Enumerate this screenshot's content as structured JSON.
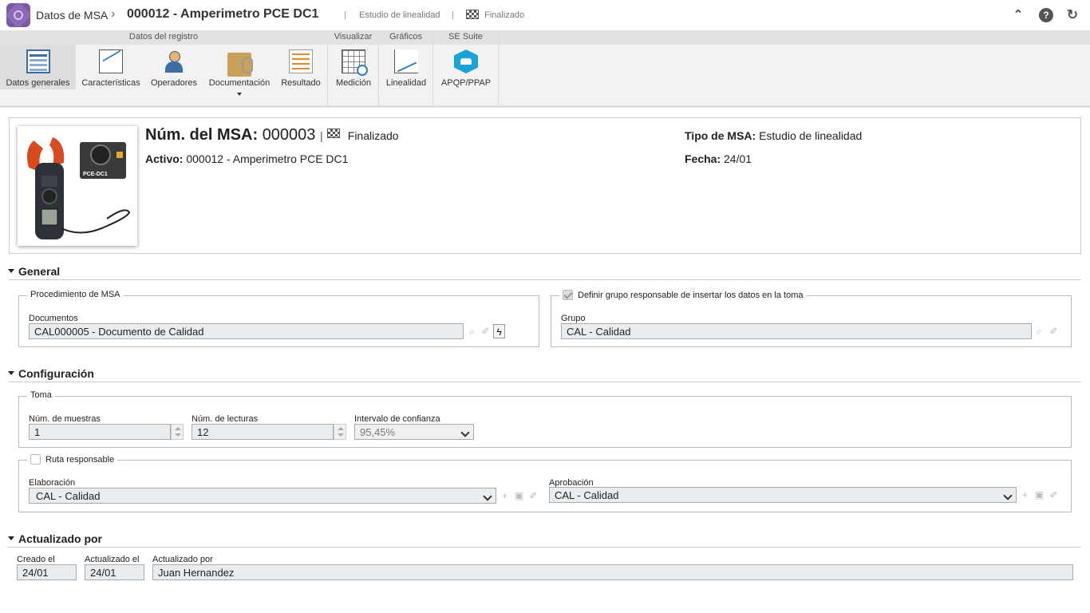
{
  "header": {
    "app_title": "Datos de MSA",
    "record_title": "000012 - Amperimetro PCE DC1",
    "study_type": "Estudio de linealidad",
    "status": "Finalizado"
  },
  "ribbon": {
    "groups": [
      {
        "label": "Datos del registro"
      },
      {
        "label": "Visualizar"
      },
      {
        "label": "Gráficos"
      },
      {
        "label": "SE Suite"
      }
    ],
    "buttons": [
      {
        "label": "Datos generales",
        "icon": "document-list-icon",
        "active": true
      },
      {
        "label": "Características",
        "icon": "chart-icon"
      },
      {
        "label": "Operadores",
        "icon": "user-icon"
      },
      {
        "label": "Documentación",
        "icon": "folder-attachment-icon"
      },
      {
        "label": "Resultado",
        "icon": "result-sheet-icon"
      },
      {
        "label": "Medición",
        "icon": "grid-magnifier-icon"
      },
      {
        "label": "Linealidad",
        "icon": "line-chart-icon"
      },
      {
        "label": "APQP/PPAP",
        "icon": "car-hexagon-icon"
      }
    ]
  },
  "record": {
    "msa_label": "Núm. del MSA:",
    "msa_number": "000003",
    "msa_status": "Finalizado",
    "asset_label": "Activo:",
    "asset_value": "000012 - Amperimetro PCE DC1",
    "type_label": "Tipo de MSA:",
    "type_value": "Estudio de linealidad",
    "date_label": "Fecha:",
    "date_value": "24/01",
    "photo_text": "PCE-DC1"
  },
  "general": {
    "title": "General",
    "procedure_legend": "Procedimiento de MSA",
    "documents_label": "Documentos",
    "documents_value": "CAL000005 - Documento de Calidad",
    "group_legend": "Definir grupo responsable de insertar los datos en la toma",
    "group_label": "Grupo",
    "group_value": "CAL - Calidad"
  },
  "config": {
    "title": "Configuración",
    "toma_legend": "Toma",
    "samples_label": "Núm. de muestras",
    "samples_value": "1",
    "readings_label": "Núm. de lecturas",
    "readings_value": "12",
    "confidence_label": "Intervalo de confianza",
    "confidence_value": "95,45%",
    "route_legend": "Ruta responsable",
    "elaboration_label": "Elaboración",
    "elaboration_value": "CAL - Calidad",
    "approval_label": "Aprobación",
    "approval_value": "CAL - Calidad"
  },
  "updated": {
    "title": "Actualizado por",
    "created_label": "Creado el",
    "created_value": "24/01",
    "updated_on_label": "Actualizado el",
    "updated_on_value": "24/01",
    "updated_by_label": "Actualizado por",
    "updated_by_value": "Juan Hernandez"
  }
}
